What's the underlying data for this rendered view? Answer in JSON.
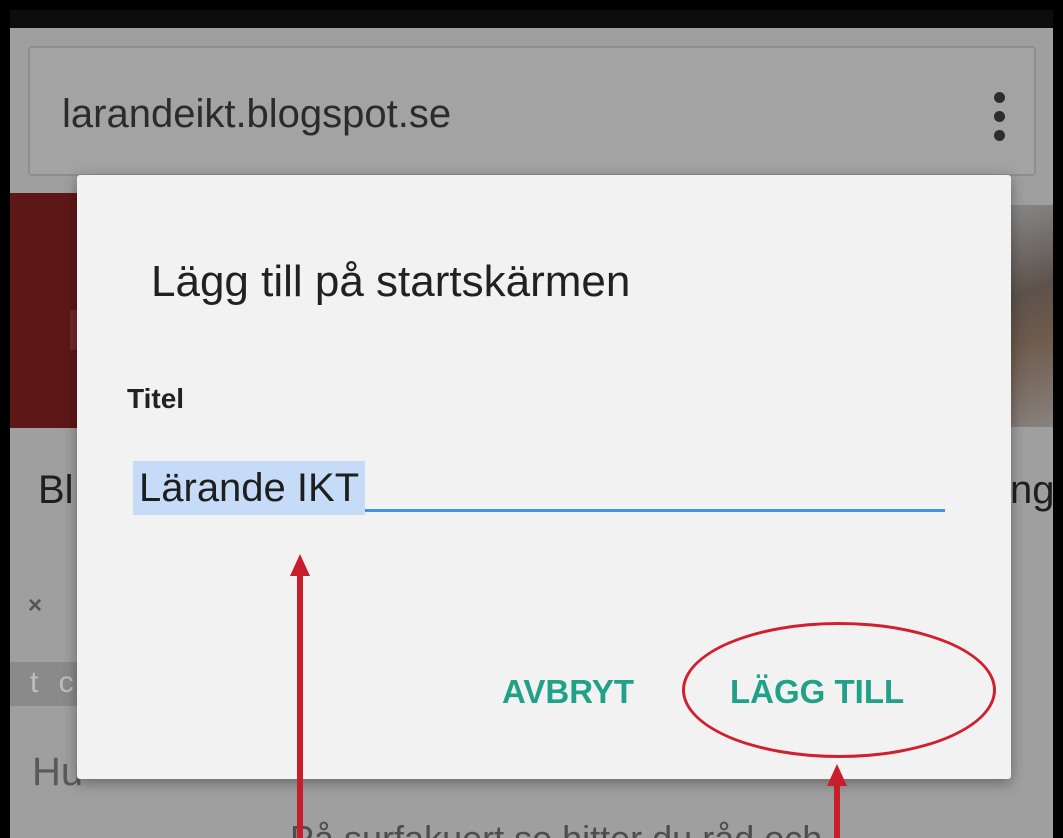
{
  "browser": {
    "url": "larandeikt.blogspot.se",
    "menu_icon": "more-vert-icon"
  },
  "background": {
    "text_left": "Bl",
    "text_right": "ng",
    "close_glyph": "×",
    "tag_text": "t c",
    "heading_fragment": "Hu",
    "bottom_text": "På surfakuert se hitter du råd och"
  },
  "dialog": {
    "title": "Lägg till på startskärmen",
    "field_label": "Titel",
    "field_value": "Lärande IKT",
    "cancel_label": "AVBRYT",
    "add_label": "LÄGG TILL"
  },
  "annotation": {
    "highlight_color": "#c81d2b"
  }
}
